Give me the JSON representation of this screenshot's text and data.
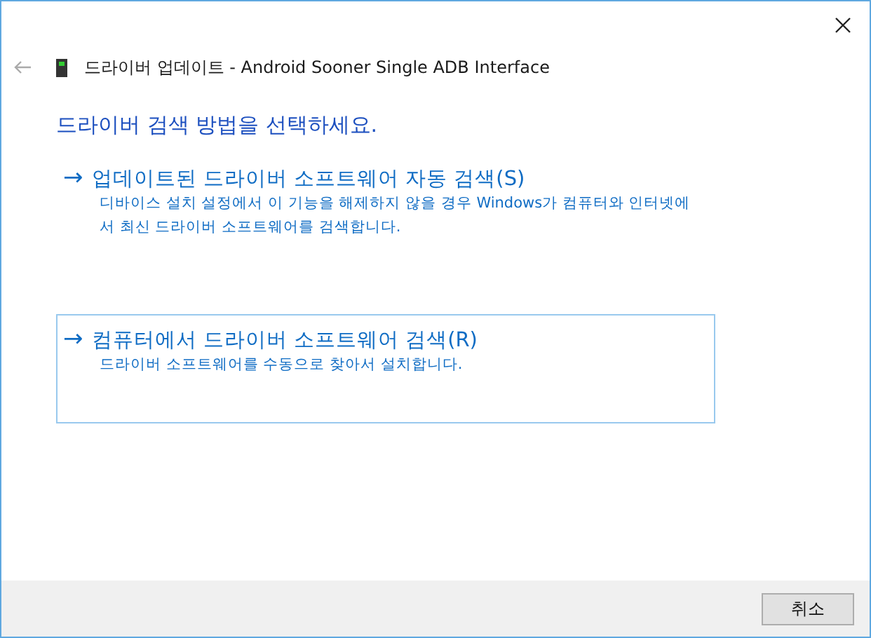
{
  "window": {
    "title": "드라이버 업데이트 - Android Sooner Single ADB Interface"
  },
  "heading": "드라이버 검색 방법을 선택하세요.",
  "options": [
    {
      "arrow": "→",
      "label": "업데이트된 드라이버 소프트웨어 자동 검색(S)",
      "description": "디바이스 설치 설정에서 이 기능을 해제하지 않을 경우 Windows가 컴퓨터와 인터넷에서 최신 드라이버 소프트웨어를 검색합니다.",
      "selected": false
    },
    {
      "arrow": "→",
      "label": "컴퓨터에서 드라이버 소프트웨어 검색(R)",
      "description": "드라이버 소프트웨어를 수동으로 찾아서 설치합니다.",
      "selected": true
    }
  ],
  "buttons": [
    "취소"
  ]
}
